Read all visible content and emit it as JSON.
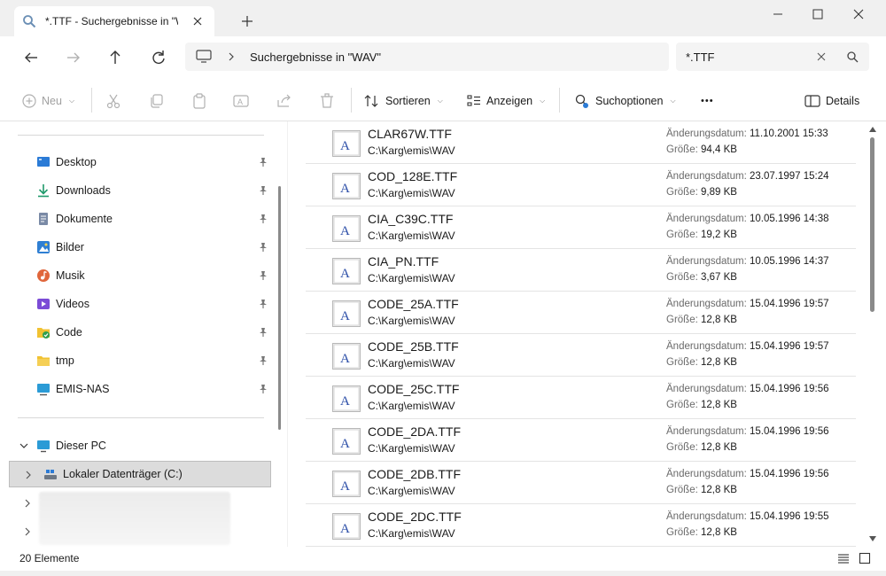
{
  "window": {
    "tab_title": "*.TTF - Suchergebnisse in \"WAV\"",
    "new_tab_icon": "plus-icon"
  },
  "address": {
    "breadcrumb": "Suchergebnisse in \"WAV\"",
    "search_value": "*.TTF"
  },
  "toolbar": {
    "new_label": "Neu",
    "sort_label": "Sortieren",
    "view_label": "Anzeigen",
    "search_options_label": "Suchoptionen",
    "more_label": "•••",
    "details_label": "Details"
  },
  "sidebar": {
    "quick_access": [
      {
        "label": "Desktop",
        "icon": "desktop-icon",
        "color": "#2b7bd6"
      },
      {
        "label": "Downloads",
        "icon": "download-icon",
        "color": "#1f9a6b"
      },
      {
        "label": "Dokumente",
        "icon": "document-icon",
        "color": "#5b6b85"
      },
      {
        "label": "Bilder",
        "icon": "pictures-icon",
        "color": "#2f7fd3"
      },
      {
        "label": "Musik",
        "icon": "music-icon",
        "color": "#e0663b"
      },
      {
        "label": "Videos",
        "icon": "videos-icon",
        "color": "#7b4bd6"
      },
      {
        "label": "Code",
        "icon": "folder-shield-icon",
        "color": "#f1c232"
      },
      {
        "label": "tmp",
        "icon": "folder-icon",
        "color": "#f1c232"
      },
      {
        "label": "EMIS-NAS",
        "icon": "network-drive-icon",
        "color": "#2b9bd6"
      }
    ],
    "this_pc": "Dieser PC",
    "local_drive": "Lokaler Datenträger (C:)"
  },
  "files": [
    {
      "name": "CLAR67W.TTF",
      "path": "C:\\Karg\\emis\\WAV",
      "date": "11.10.2001 15:33",
      "size": "94,4 KB"
    },
    {
      "name": "COD_128E.TTF",
      "path": "C:\\Karg\\emis\\WAV",
      "date": "23.07.1997 15:24",
      "size": "9,89 KB"
    },
    {
      "name": "CIA_C39C.TTF",
      "path": "C:\\Karg\\emis\\WAV",
      "date": "10.05.1996 14:38",
      "size": "19,2 KB"
    },
    {
      "name": "CIA_PN.TTF",
      "path": "C:\\Karg\\emis\\WAV",
      "date": "10.05.1996 14:37",
      "size": "3,67 KB"
    },
    {
      "name": "CODE_25A.TTF",
      "path": "C:\\Karg\\emis\\WAV",
      "date": "15.04.1996 19:57",
      "size": "12,8 KB"
    },
    {
      "name": "CODE_25B.TTF",
      "path": "C:\\Karg\\emis\\WAV",
      "date": "15.04.1996 19:57",
      "size": "12,8 KB"
    },
    {
      "name": "CODE_25C.TTF",
      "path": "C:\\Karg\\emis\\WAV",
      "date": "15.04.1996 19:56",
      "size": "12,8 KB"
    },
    {
      "name": "CODE_2DA.TTF",
      "path": "C:\\Karg\\emis\\WAV",
      "date": "15.04.1996 19:56",
      "size": "12,8 KB"
    },
    {
      "name": "CODE_2DB.TTF",
      "path": "C:\\Karg\\emis\\WAV",
      "date": "15.04.1996 19:56",
      "size": "12,8 KB"
    },
    {
      "name": "CODE_2DC.TTF",
      "path": "C:\\Karg\\emis\\WAV",
      "date": "15.04.1996 19:55",
      "size": "12,8 KB"
    }
  ],
  "labels": {
    "modified": "Änderungsdatum:",
    "size": "Größe:"
  },
  "status": {
    "count": "20 Elemente"
  }
}
